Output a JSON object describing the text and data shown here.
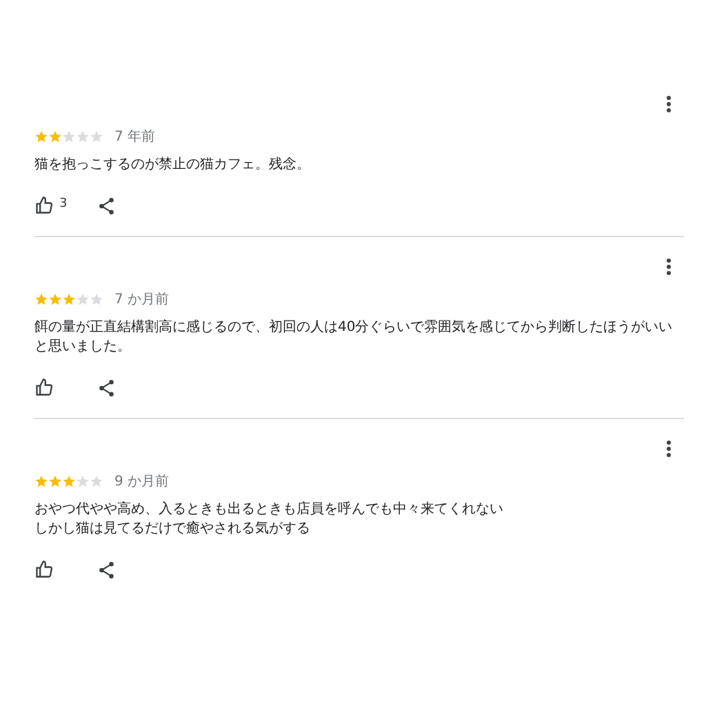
{
  "reviews": [
    {
      "stars": 2,
      "time": "7 年前",
      "lines": [
        "猫を抱っこするのが禁止の猫カフェ。残念。"
      ],
      "likes": "3"
    },
    {
      "stars": 3,
      "time": "7 か月前",
      "lines": [
        "餌の量が正直結構割高に感じるので、初回の人は40分ぐらいで雰囲気を感じてから判断したほうがいいと思いました。"
      ]
    },
    {
      "stars": 3,
      "time": "9 か月前",
      "lines": [
        "おやつ代やや高め、入るときも出るときも店員を呼んでも中々来てくれない",
        "しかし猫は見てるだけで癒やされる気がする"
      ]
    }
  ]
}
